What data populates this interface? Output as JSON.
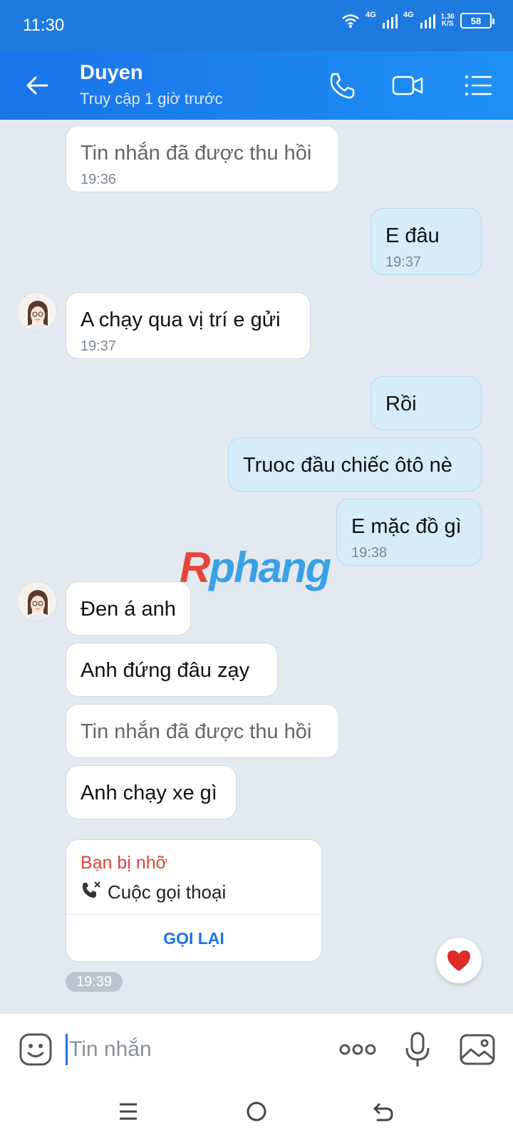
{
  "status_bar": {
    "time": "11:30",
    "net1": "4G",
    "net2": "4G",
    "speed": "1,36",
    "speed_unit": "K/S",
    "battery": "58"
  },
  "header": {
    "name": "Duyen",
    "status": "Truy cập 1 giờ trước",
    "icons": [
      "back-arrow-icon",
      "phone-icon",
      "video-camera-icon",
      "menu-list-icon"
    ]
  },
  "messages": [
    {
      "direction": "in",
      "text": "Tin nhắn đã được thu hồi",
      "time": "19:36",
      "recalled": true
    },
    {
      "direction": "out",
      "text": "E đâu",
      "time": "19:37"
    },
    {
      "direction": "in",
      "text": "A chạy qua vị trí e gửi",
      "time": "19:37"
    },
    {
      "direction": "out",
      "text": "Rồi",
      "time": ""
    },
    {
      "direction": "out",
      "text": "Truoc đầu chiếc ôtô nè",
      "time": ""
    },
    {
      "direction": "out",
      "text": "E mặc đồ gì",
      "time": "19:38"
    },
    {
      "direction": "in",
      "text": "Đen á anh",
      "time": ""
    },
    {
      "direction": "in",
      "text": "Anh đứng đâu zạy",
      "time": ""
    },
    {
      "direction": "in",
      "text": "Tin nhắn đã được thu hồi",
      "time": "",
      "recalled": true
    },
    {
      "direction": "in",
      "text": "Anh chạy xe gì",
      "time": ""
    }
  ],
  "missed_call": {
    "title": "Bạn bị nhỡ",
    "subtitle": "Cuộc gọi thoại",
    "action": "GỌI LẠI",
    "time": "19:39"
  },
  "watermark": {
    "part1": "R",
    "part2": "phang"
  },
  "input": {
    "placeholder": "Tin nhắn",
    "value": ""
  },
  "colors": {
    "header": "#1a73e8",
    "outgoing_bubble": "#d6ecfb",
    "incoming_bubble": "#ffffff",
    "missed": "#e0433b",
    "background": "#e2e9f1"
  }
}
